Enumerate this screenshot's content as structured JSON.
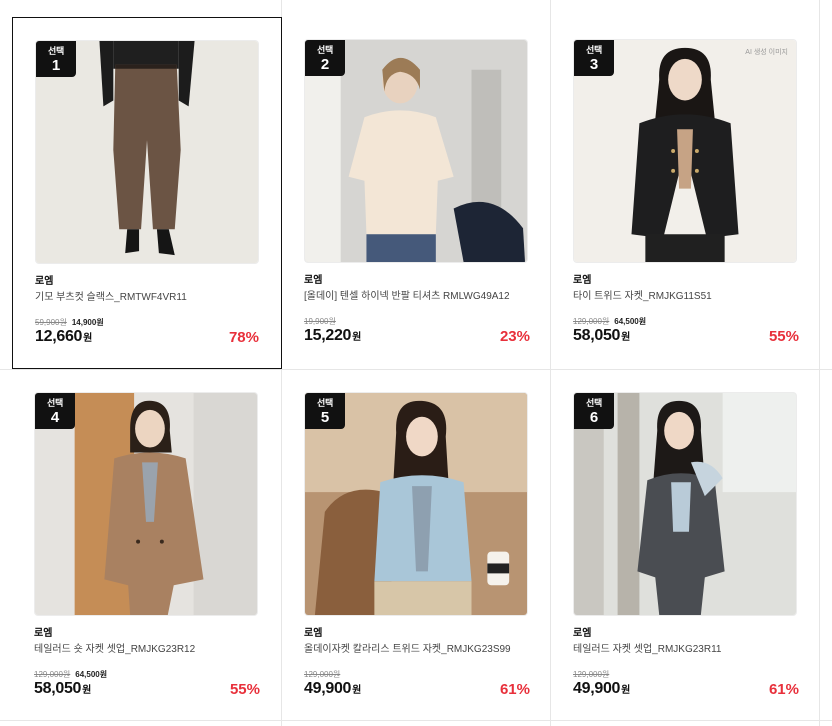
{
  "rank_label": "선택",
  "currency_unit": "원",
  "products": [
    {
      "rank": "1",
      "brand": "로엠",
      "name": "기모 부츠컷 슬랙스_RMTWF4VR11",
      "original_price": "59,900원",
      "coupon_price": "14,900원",
      "price": "12,660",
      "discount": "78%",
      "ai_tag": ""
    },
    {
      "rank": "2",
      "brand": "로엠",
      "name": "[올데이] 텐셀 하이넥 반팔 티셔츠 RMLWG49A12",
      "original_price": "19,900원",
      "coupon_price": "",
      "price": "15,220",
      "discount": "23%",
      "ai_tag": ""
    },
    {
      "rank": "3",
      "brand": "로엠",
      "name": "타이 트위드 자켓_RMJKG11S51",
      "original_price": "129,000원",
      "coupon_price": "64,500원",
      "price": "58,050",
      "discount": "55%",
      "ai_tag": "AI 생성 이미지"
    },
    {
      "rank": "4",
      "brand": "로엠",
      "name": "테일러드 숏 자켓 셋업_RMJKG23R12",
      "original_price": "129,000원",
      "coupon_price": "64,500원",
      "price": "58,050",
      "discount": "55%",
      "ai_tag": ""
    },
    {
      "rank": "5",
      "brand": "로엠",
      "name": "올데이자켓 칼라리스 트위드 자켓_RMJKG23S99",
      "original_price": "129,000원",
      "coupon_price": "",
      "price": "49,900",
      "discount": "61%",
      "ai_tag": ""
    },
    {
      "rank": "6",
      "brand": "로엠",
      "name": "테일러드 자켓 셋업_RMJKG23R11",
      "original_price": "129,000원",
      "coupon_price": "",
      "price": "49,900",
      "discount": "61%",
      "ai_tag": ""
    }
  ],
  "colors": {
    "discount": "#e8303b",
    "rank_badge": "#111111"
  }
}
